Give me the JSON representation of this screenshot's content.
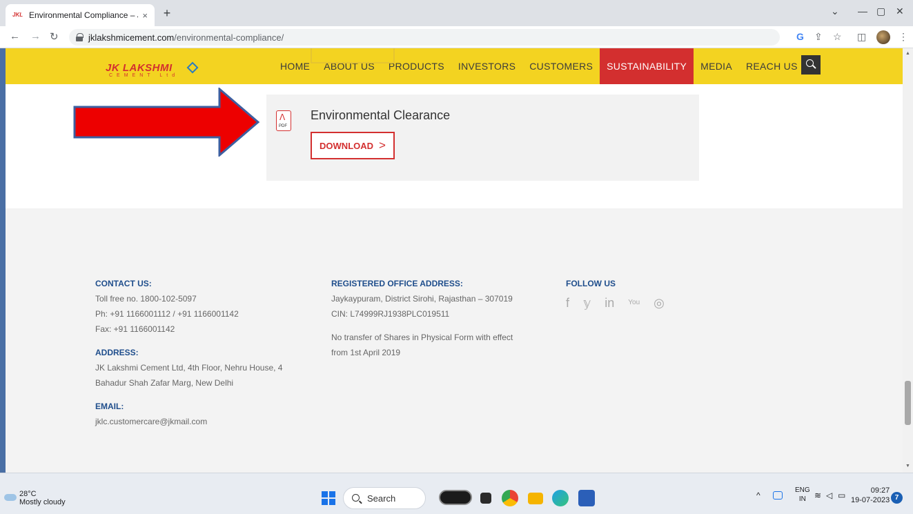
{
  "browser": {
    "tab_title": "Environmental Compliance – JK L",
    "tab_close": "×",
    "new_tab": "+",
    "url_host": "jklakshmicement.com",
    "url_path": "/environmental-compliance/",
    "icons": [
      "back-arrow-icon",
      "forward-arrow-icon",
      "reload-icon",
      "lock-icon",
      "google-icon",
      "share-icon",
      "star-icon",
      "sidepanel-icon",
      "profile-avatar",
      "menu-dots-icon"
    ]
  },
  "site": {
    "logo_text": "JK LAKSHMI",
    "logo_sub": "CEMENT Ltd",
    "nav": [
      "HOME",
      "ABOUT US",
      "PRODUCTS",
      "INVESTORS",
      "CUSTOMERS",
      "SUSTAINABILITY",
      "MEDIA",
      "REACH US"
    ],
    "active_nav": "SUSTAINABILITY",
    "colors": {
      "header": "#f3d321",
      "accent": "#d32f2f",
      "footer_heading": "#1f4e8c"
    }
  },
  "document": {
    "title": "Environmental Clearance",
    "file_label": "PDF",
    "download_label": "DOWNLOAD",
    "download_chevron": ">"
  },
  "footer": {
    "contact_heading": "CONTACT US:",
    "contact_lines": [
      "Toll free no. 1800-102-5097",
      "Ph: +91 1166001112 / +91 1166001142",
      "Fax: +91 1166001142"
    ],
    "address_heading": "ADDRESS:",
    "address_lines": [
      "JK Lakshmi Cement Ltd, 4th Floor, Nehru House, 4",
      "Bahadur Shah Zafar Marg, New Delhi"
    ],
    "email_heading": "EMAIL:",
    "email": "jklc.customercare@jkmail.com",
    "registered_heading": "REGISTERED OFFICE ADDRESS:",
    "registered_lines": [
      "Jaykaypuram, District Sirohi, Rajasthan – 307019",
      "CIN: L74999RJ1938PLC019511"
    ],
    "notice_lines": [
      "No transfer of Shares in Physical Form with effect",
      "from 1st April 2019"
    ],
    "follow_heading": "FOLLOW US",
    "social": [
      "f",
      "𝕪",
      "in",
      "You",
      "◎"
    ]
  },
  "taskbar": {
    "temperature": "28°C",
    "weather": "Mostly cloudy",
    "search_label": "Search",
    "lang_top": "ENG",
    "lang_bottom": "IN",
    "time": "09:27",
    "date": "19-07-2023",
    "notifications": "7",
    "tray_chevron": "^"
  }
}
